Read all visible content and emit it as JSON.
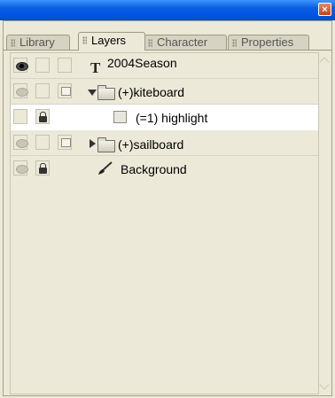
{
  "window": {
    "close_glyph": "×"
  },
  "tabs": [
    {
      "label": "Library",
      "active": false
    },
    {
      "label": "Layers",
      "active": true
    },
    {
      "label": "Character",
      "active": false
    },
    {
      "label": "Properties",
      "active": false
    }
  ],
  "layers": [
    {
      "name": "2004Season",
      "icon": "text-type-icon",
      "visible": true,
      "locked": false,
      "selected": false
    },
    {
      "name": "(+)kiteboard",
      "icon": "folder-icon",
      "expanded": true,
      "visible": false,
      "locked": false,
      "selected": false
    },
    {
      "name": "(=1) highlight",
      "icon": "layer-icon",
      "visible": null,
      "locked": true,
      "selected": true
    },
    {
      "name": "(+)sailboard",
      "icon": "folder-icon",
      "expanded": false,
      "visible": false,
      "locked": false,
      "selected": false
    },
    {
      "name": "Background",
      "icon": "paintbrush-icon",
      "visible": false,
      "locked": true,
      "selected": false
    }
  ],
  "colors": {
    "titlebar": "#0055E5",
    "panel_bg": "#ECE9D8",
    "selected_row": "#FFFFFF"
  }
}
